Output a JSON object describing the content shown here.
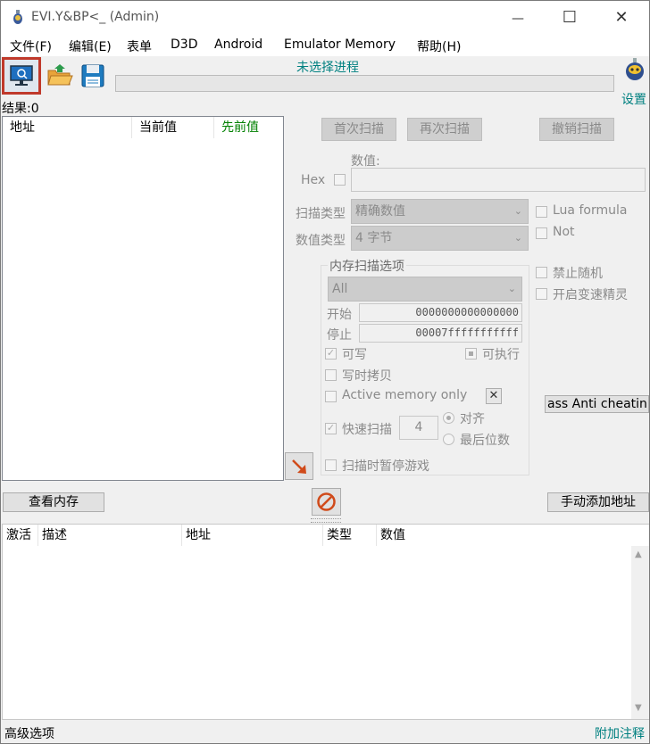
{
  "window": {
    "title": "EVI.Y&BP<_ (Admin)",
    "minimize_glyph": "—",
    "maximize_glyph": "☐",
    "close_glyph": "✕"
  },
  "menu": [
    "文件(F)",
    "编辑(E)",
    "表单",
    "D3D",
    "Android",
    "Emulator Memory",
    "帮助(H)"
  ],
  "toolbar": {
    "process_label": "未选择进程",
    "settings_label": "设置",
    "process_color": "#008080"
  },
  "results": {
    "label": "结果:0"
  },
  "found_list": {
    "columns": [
      "地址",
      "当前值",
      "先前值"
    ],
    "previous_color": "#008000"
  },
  "scan": {
    "first_scan": "首次扫描",
    "next_scan": "再次扫描",
    "undo_scan": "撤销扫描",
    "value_label": "数值:",
    "hex_label": "Hex",
    "scan_type_label": "扫描类型",
    "scan_type_value": "精确数值",
    "value_type_label": "数值类型",
    "value_type_value": "4 字节",
    "lua_formula": "Lua formula",
    "not_label": "Not",
    "mem_options_title": "内存扫描选项",
    "region_value": "All",
    "start_label": "开始",
    "start_value": "0000000000000000",
    "stop_label": "停止",
    "stop_value": "00007fffffffffff",
    "writable": "可写",
    "executable": "可执行",
    "copy_on_write": "写时拷贝",
    "active_memory_only": "Active memory only",
    "fast_scan": "快速扫描",
    "fast_scan_value": "4",
    "align": "对齐",
    "last_digits": "最后位数",
    "pause_game": "扫描时暂停游戏",
    "disable_random": "禁止随机",
    "enable_speedhack": "开启变速精灵",
    "anti_cheat_button": "ass Anti cheatin"
  },
  "bottom": {
    "view_memory": "查看内存",
    "add_address": "手动添加地址",
    "columns": [
      "激活",
      "描述",
      "地址",
      "类型",
      "数值"
    ],
    "advanced_options": "高级选项",
    "add_comment": "附加注释",
    "comment_color": "#008080"
  }
}
